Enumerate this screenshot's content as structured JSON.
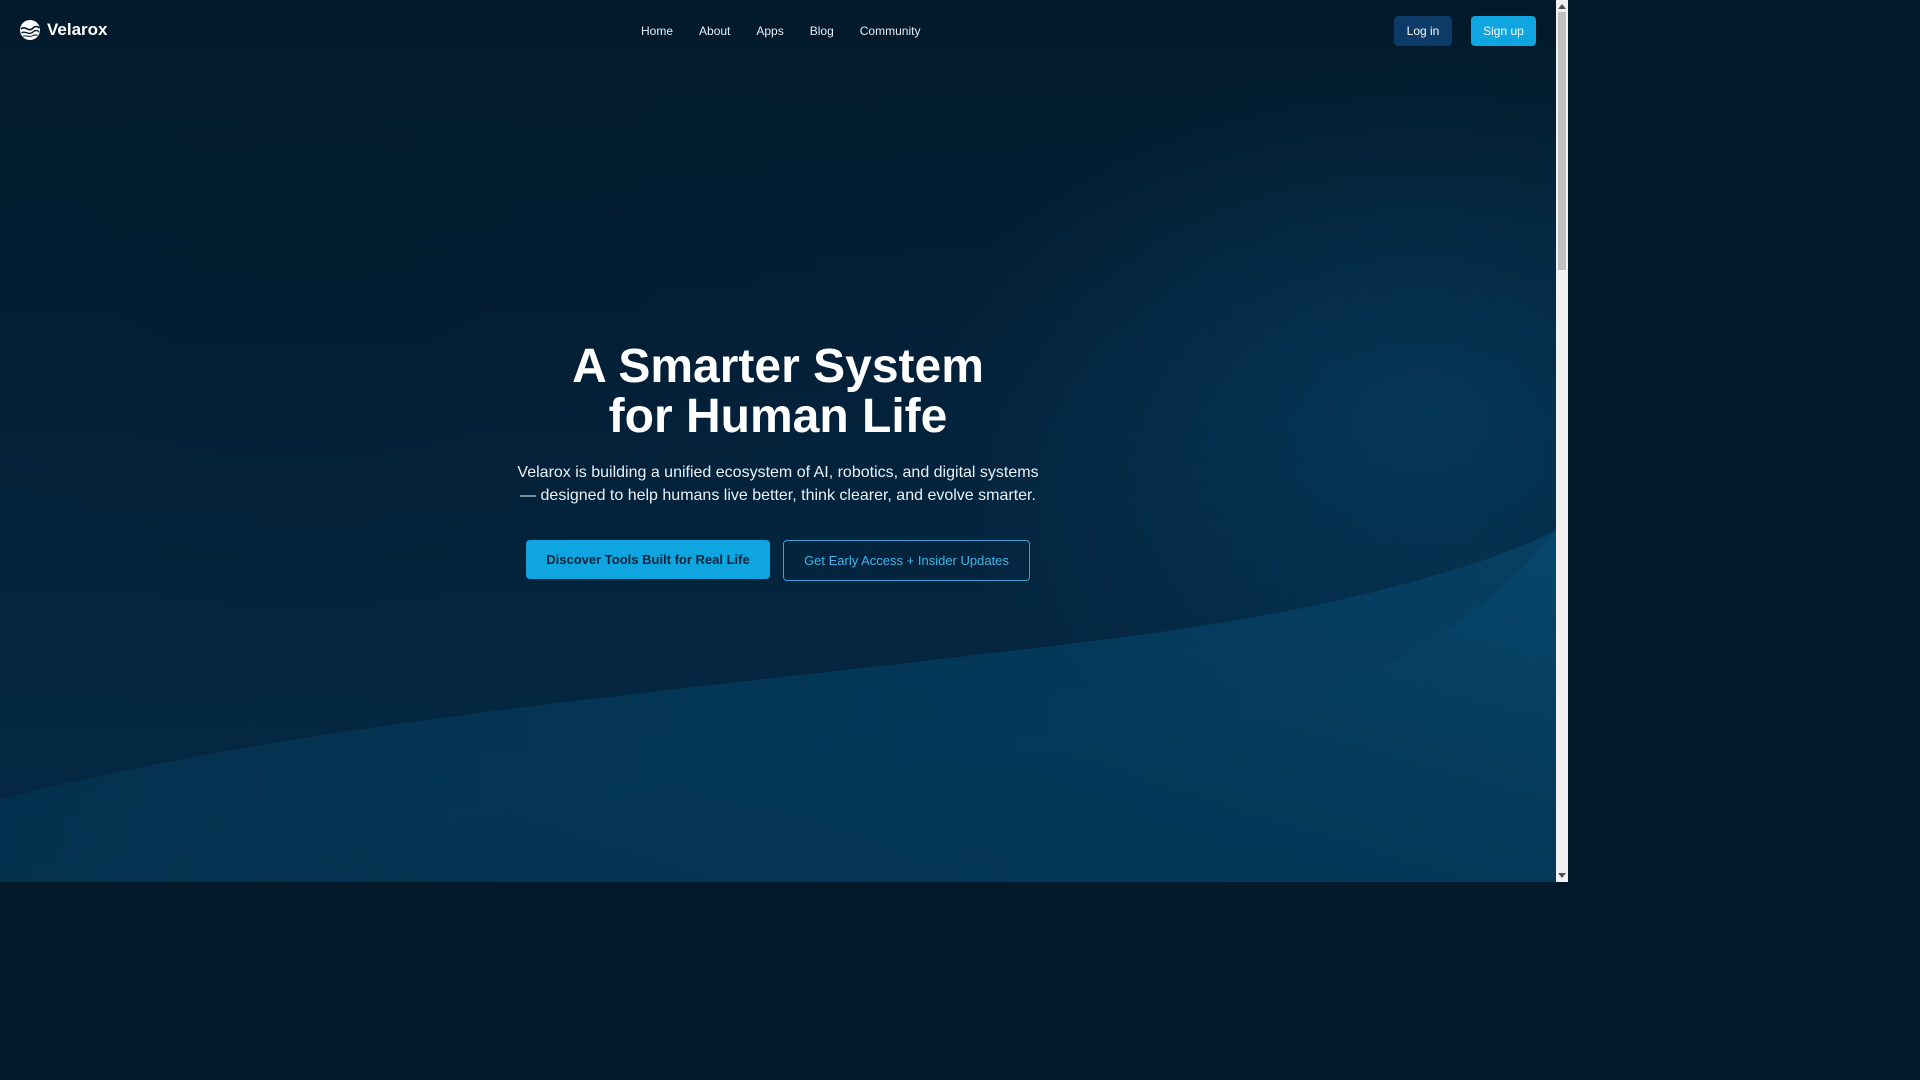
{
  "brand": {
    "name": "Velarox",
    "logo_icon": "wave-globe-icon"
  },
  "nav": {
    "items": [
      {
        "label": "Home"
      },
      {
        "label": "About"
      },
      {
        "label": "Apps"
      },
      {
        "label": "Blog"
      },
      {
        "label": "Community"
      }
    ]
  },
  "auth": {
    "login_label": "Log in",
    "signup_label": "Sign up"
  },
  "hero": {
    "title_line1": "A Smarter System",
    "title_line2": "for Human Life",
    "subtitle_line1": "Velarox is building a unified ecosystem of AI, robotics, and digital systems",
    "subtitle_line2": "— designed to help humans live better, think clearer, and evolve smarter.",
    "primary_cta": "Discover Tools Built for Real Life",
    "secondary_cta": "Get Early Access + Insider Updates"
  },
  "colors": {
    "background": "#031a2a",
    "accent": "#0ea5e0",
    "login_button": "#0b3b66",
    "outline_text": "#3fb6e8"
  }
}
